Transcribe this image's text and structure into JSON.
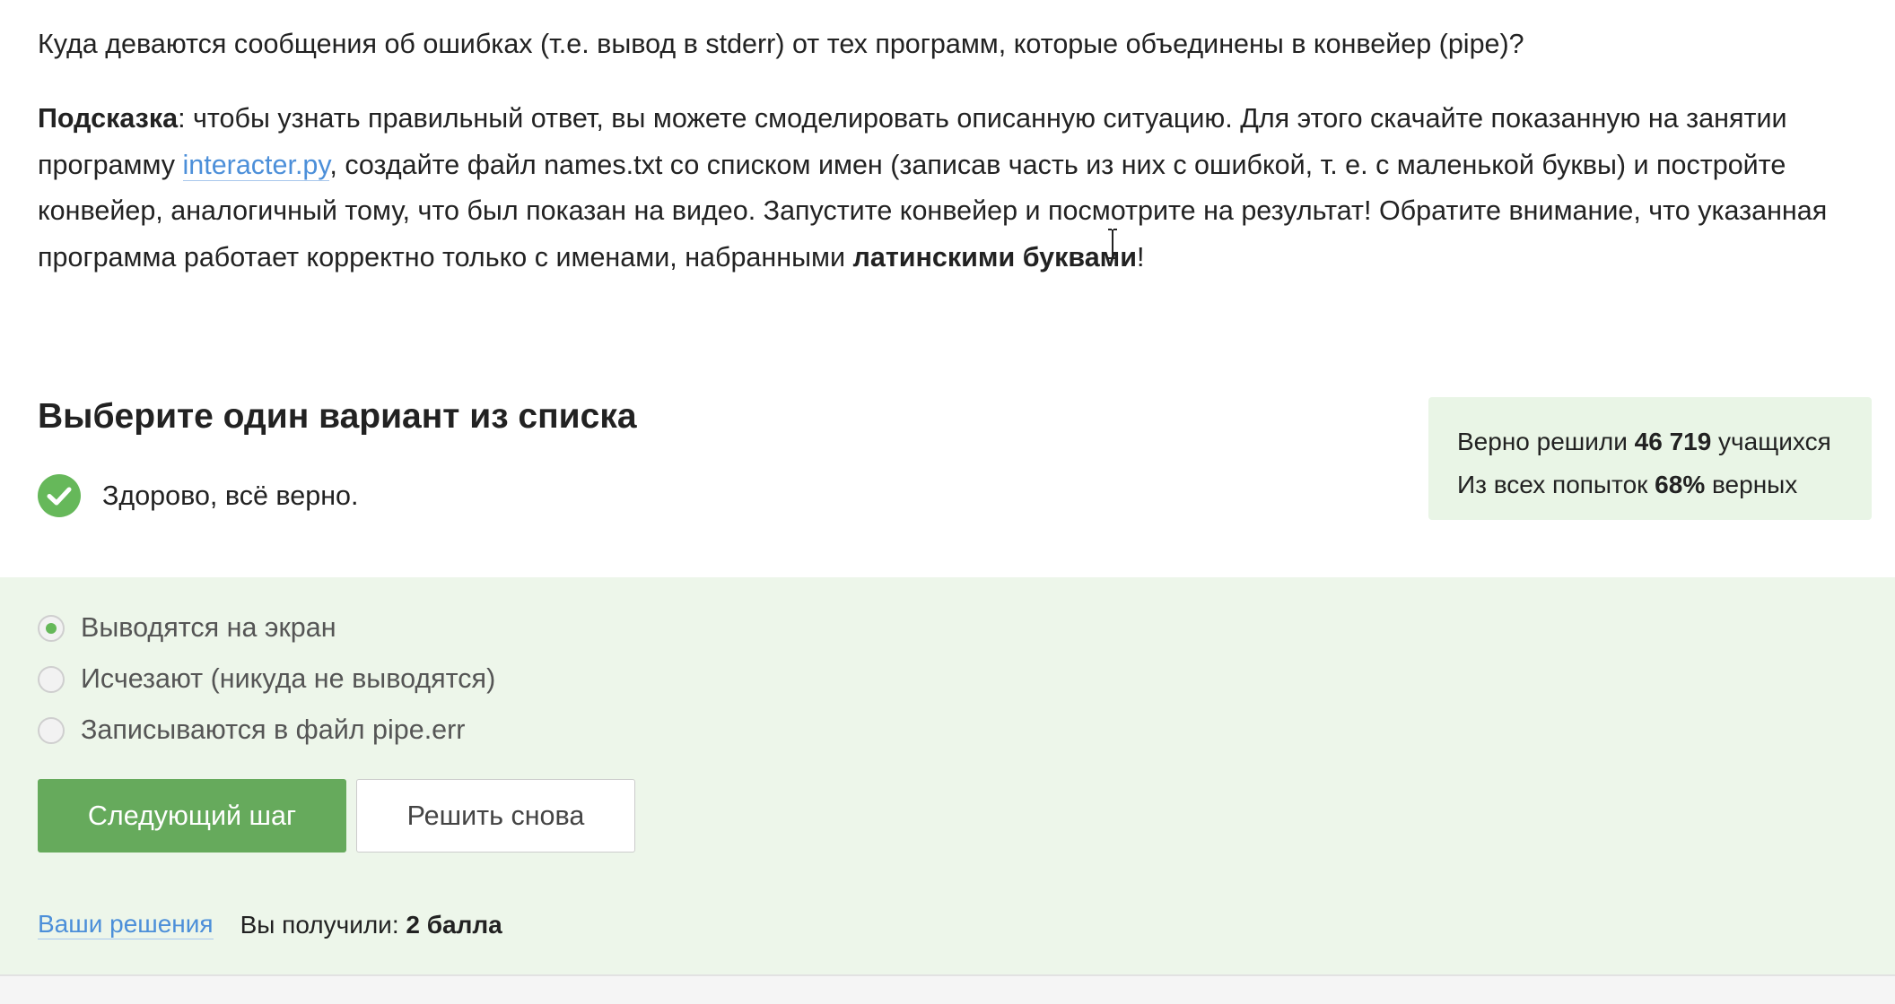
{
  "question": "Куда деваются сообщения об ошибках (т.е. вывод в stderr) от тех программ, которые объединены в конвейер (pipe)?",
  "hint": {
    "label": "Подсказка",
    "text1": ": чтобы узнать правильный ответ, вы можете смоделировать описанную ситуацию. Для этого скачайте показанную на занятии программу ",
    "link": "interacter.py",
    "text2": ", создайте файл names.txt со списком имен (записав часть из них с ошибкой, т. е. с маленькой буквы) и постройте конвейер, аналогичный тому, что был показан на видео. Запустите конвейер и посмотрите на результат! Обратите внимание, что указанная программа работает корректно только с именами, набранными ",
    "bold_end": "латинскими буквами",
    "text3": "!"
  },
  "section_title": "Выберите один вариант из списка",
  "status_text": "Здорово, всё верно.",
  "stats": {
    "solved_prefix": "Верно решили ",
    "solved_count": "46 719",
    "solved_suffix": " учащихся",
    "attempts_prefix": "Из всех попыток ",
    "attempts_percent": "68%",
    "attempts_suffix": " верных"
  },
  "options": [
    {
      "label": "Выводятся на экран",
      "selected": true
    },
    {
      "label": "Исчезают (никуда не выводятся)",
      "selected": false
    },
    {
      "label": "Записываются в файл pipe.err",
      "selected": false
    }
  ],
  "buttons": {
    "next": "Следующий шаг",
    "retry": "Решить снова"
  },
  "footer": {
    "solutions_link": "Ваши решения",
    "score_prefix": "Вы получили: ",
    "score_value": "2 балла"
  },
  "colors": {
    "accent_green": "#66aa5c",
    "panel_bg": "#edf6ea",
    "link_blue": "#4c8fd9"
  },
  "icons": {
    "status": "checkmark-circle-icon",
    "cursor": "text-cursor-icon"
  }
}
